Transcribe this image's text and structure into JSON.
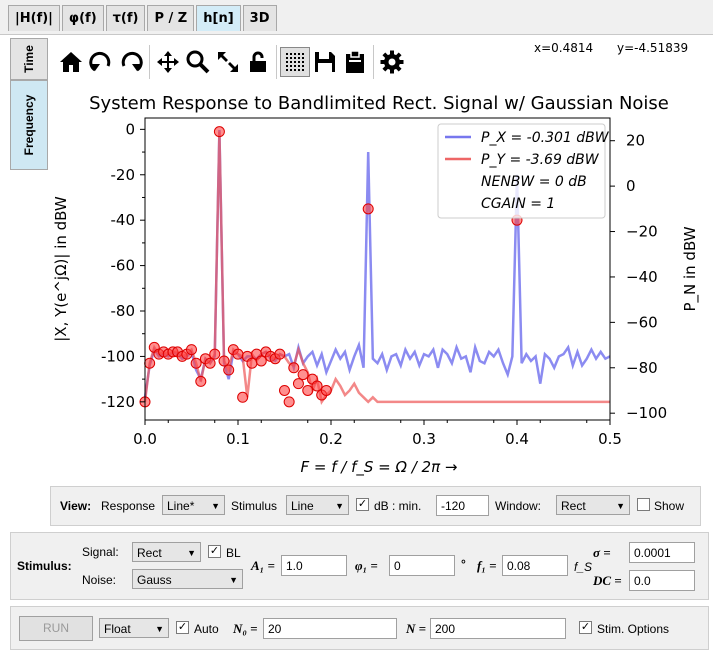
{
  "tabs": [
    {
      "label": "|H(f)|",
      "active": false
    },
    {
      "label": "φ(f)",
      "active": false
    },
    {
      "label": "τ(f)",
      "active": false
    },
    {
      "label": "P / Z",
      "active": false
    },
    {
      "label": "h[n]",
      "active": true
    },
    {
      "label": "3D",
      "active": false
    }
  ],
  "side_tabs": {
    "time": "Time",
    "frequency": "Frequency"
  },
  "toolbar": {
    "icons": [
      "home-icon",
      "back-icon",
      "forward-icon",
      "pan-icon",
      "zoom-icon",
      "autoscale-icon",
      "lock-icon",
      "grid-icon",
      "save-icon",
      "clipboard-icon",
      "settings-icon"
    ]
  },
  "coords": {
    "x": "x=0.4814",
    "y": "y=-4.51839"
  },
  "chart_data": {
    "type": "line",
    "title": "System Response to Bandlimited Rect. Signal w/ Gaussian Noise",
    "xlabel": "F = f / f_S = Ω / 2π →",
    "ylabel": "|X, Y(e^jΩ)| in dBW",
    "ylabel_right": "P_N in dBW",
    "xlim": [
      0,
      0.5
    ],
    "ylim": [
      -128,
      5
    ],
    "ylim_right": [
      -103,
      30
    ],
    "xticks": [
      0.0,
      0.1,
      0.2,
      0.3,
      0.4,
      0.5
    ],
    "yticks": [
      0,
      -20,
      -40,
      -60,
      -80,
      -100,
      -120
    ],
    "yticks_right": [
      20,
      0,
      -20,
      -40,
      -60,
      -80,
      -100
    ],
    "legend_position": "top-right",
    "legend": [
      {
        "label": "P_X = -0.301 dBW",
        "color": "#7777ee"
      },
      {
        "label": "P_Y = -3.69 dBW",
        "color": "#ee6666"
      },
      {
        "label": "NENBW = 0 dB"
      },
      {
        "label": "CGAIN  = 1"
      }
    ],
    "series": [
      {
        "name": "X",
        "color": "#7777ee",
        "x": [
          0,
          0.005,
          0.01,
          0.015,
          0.02,
          0.025,
          0.03,
          0.035,
          0.04,
          0.045,
          0.05,
          0.055,
          0.06,
          0.065,
          0.07,
          0.075,
          0.08,
          0.085,
          0.09,
          0.095,
          0.1,
          0.105,
          0.11,
          0.115,
          0.12,
          0.125,
          0.13,
          0.135,
          0.14,
          0.145,
          0.15,
          0.155,
          0.16,
          0.165,
          0.17,
          0.175,
          0.18,
          0.185,
          0.19,
          0.195,
          0.2,
          0.205,
          0.21,
          0.215,
          0.22,
          0.225,
          0.23,
          0.235,
          0.24,
          0.245,
          0.25,
          0.255,
          0.26,
          0.265,
          0.27,
          0.275,
          0.28,
          0.285,
          0.29,
          0.295,
          0.3,
          0.305,
          0.31,
          0.315,
          0.32,
          0.325,
          0.33,
          0.335,
          0.34,
          0.345,
          0.35,
          0.355,
          0.36,
          0.365,
          0.37,
          0.375,
          0.38,
          0.385,
          0.39,
          0.395,
          0.4,
          0.405,
          0.41,
          0.415,
          0.42,
          0.425,
          0.43,
          0.435,
          0.44,
          0.445,
          0.45,
          0.455,
          0.46,
          0.465,
          0.47,
          0.475,
          0.48,
          0.485,
          0.49,
          0.495,
          0.5
        ],
        "y": [
          -118,
          -104,
          -97,
          -100,
          -99,
          -100,
          -98,
          -99,
          -101,
          -100,
          -98,
          -106,
          -110,
          -101,
          -103,
          -100,
          -0.3,
          -103,
          -110,
          -98,
          -99,
          -102,
          -100,
          -100,
          -101,
          -99,
          -98,
          -101,
          -102,
          -99,
          -100,
          -99,
          -105,
          -96,
          -103,
          -100,
          -98,
          -104,
          -99,
          -107,
          -102,
          -97,
          -101,
          -98,
          -106,
          -100,
          -95,
          -105,
          -10,
          -101,
          -103,
          -99,
          -106,
          -100,
          -99,
          -104,
          -97,
          -101,
          -98,
          -104,
          -99,
          -100,
          -97,
          -105,
          -97,
          -99,
          -103,
          -96,
          -101,
          -100,
          -107,
          -96,
          -102,
          -103,
          -98,
          -100,
          -97,
          -103,
          -108,
          -100,
          -20,
          -103,
          -99,
          -102,
          -100,
          -112,
          -99,
          -101,
          -105,
          -100,
          -99,
          -96,
          -104,
          -98,
          -104,
          -101,
          -97,
          -101,
          -98,
          -101,
          -100
        ]
      },
      {
        "name": "Y",
        "color": "#ee5555",
        "x": [
          0,
          0.005,
          0.01,
          0.015,
          0.02,
          0.025,
          0.03,
          0.035,
          0.04,
          0.045,
          0.05,
          0.055,
          0.06,
          0.065,
          0.07,
          0.075,
          0.08,
          0.085,
          0.09,
          0.095,
          0.1,
          0.105,
          0.11,
          0.115,
          0.12,
          0.125,
          0.13,
          0.135,
          0.14,
          0.145,
          0.15,
          0.155,
          0.16,
          0.165,
          0.17,
          0.175,
          0.18,
          0.185,
          0.19,
          0.195,
          0.2,
          0.205,
          0.21,
          0.215,
          0.22,
          0.225,
          0.23,
          0.235,
          0.24,
          0.245,
          0.25,
          0.255,
          0.26,
          0.265,
          0.27,
          0.275,
          0.28,
          0.285,
          0.29,
          0.295,
          0.3,
          0.305,
          0.31,
          0.315,
          0.32,
          0.325,
          0.33,
          0.335,
          0.34,
          0.345,
          0.35,
          0.355,
          0.36,
          0.365,
          0.37,
          0.375,
          0.38,
          0.385,
          0.39,
          0.395,
          0.4,
          0.405,
          0.41,
          0.415,
          0.42,
          0.425,
          0.43,
          0.435,
          0.44,
          0.445,
          0.45,
          0.455,
          0.46,
          0.465,
          0.47,
          0.475,
          0.48,
          0.485,
          0.49,
          0.495,
          0.5
        ],
        "y": [
          -120,
          -103,
          -96,
          -99,
          -98,
          -99,
          -98,
          -98,
          -100,
          -99,
          -97,
          -103,
          -111,
          -101,
          -103,
          -99,
          -1,
          -102,
          -106,
          -97,
          -99,
          -100,
          -118,
          -99,
          -102,
          -99,
          -98,
          -100,
          -101,
          -99,
          -100,
          -103,
          -104,
          -97,
          -103,
          -107,
          -115,
          -110,
          -120,
          -117,
          -115,
          -110,
          -113,
          -117,
          -115,
          -112,
          -116,
          -118,
          -120,
          -118,
          -120,
          -120,
          -120,
          -120,
          -120,
          -120,
          -120,
          -120,
          -120,
          -120,
          -120,
          -120,
          -120,
          -120,
          -120,
          -120,
          -120,
          -120,
          -120,
          -120,
          -120,
          -120,
          -120,
          -120,
          -120,
          -120,
          -120,
          -120,
          -120,
          -120,
          -120,
          -120,
          -120,
          -120,
          -120,
          -120,
          -120,
          -120,
          -120,
          -120,
          -120,
          -120,
          -120,
          -120,
          -120,
          -120,
          -120,
          -120,
          -120,
          -120,
          -120
        ],
        "marker_x": [
          0,
          0.005,
          0.01,
          0.015,
          0.02,
          0.025,
          0.03,
          0.035,
          0.04,
          0.045,
          0.05,
          0.055,
          0.06,
          0.065,
          0.07,
          0.075,
          0.08,
          0.085,
          0.09,
          0.095,
          0.1,
          0.105,
          0.11,
          0.115,
          0.12,
          0.125,
          0.13,
          0.135,
          0.14,
          0.145,
          0.15,
          0.155,
          0.16,
          0.165,
          0.17,
          0.175,
          0.18,
          0.185,
          0.19,
          0.195,
          0.24,
          0.4
        ],
        "marker_y": [
          -120,
          -103,
          -96,
          -99,
          -98,
          -99,
          -98,
          -98,
          -100,
          -99,
          -97,
          -103,
          -111,
          -101,
          -103,
          -99,
          -1,
          -102,
          -106,
          -97,
          -99,
          -118,
          -100,
          -103,
          -99,
          -102,
          -98,
          -100,
          -101,
          -99,
          -115,
          -120,
          -105,
          -112,
          -108,
          -115,
          -110,
          -113,
          -117,
          -115,
          -35,
          -40
        ]
      }
    ]
  },
  "view": {
    "label": "View:",
    "response_label": "Response",
    "response_value": "Line*",
    "stimulus_label": "Stimulus",
    "stimulus_value": "Line",
    "db_label": "dB : min.",
    "db_checked": "✓",
    "db_min": "-120",
    "window_label": "Window:",
    "window_value": "Rect",
    "show_label": "Show"
  },
  "stimulus": {
    "label": "Stimulus:",
    "signal_label": "Signal:",
    "signal_value": "Rect",
    "bl_label": "BL",
    "bl_checked": "✓",
    "a1_label": "A₁ =",
    "a1_value": "1.0",
    "phi1_label": "φ₁ =",
    "phi1_value": "0",
    "deg_label": "°",
    "f1_label": "f₁ =",
    "f1_value": "0.08",
    "fs_label": "f_S",
    "sigma_label": "σ =",
    "sigma_value": "0.0001",
    "dc_label": "DC =",
    "dc_value": "0.0",
    "noise_label": "Noise:",
    "noise_value": "Gauss"
  },
  "run": {
    "run_label": "RUN",
    "format_value": "Float",
    "auto_label": "Auto",
    "auto_checked": "✓",
    "n0_label": "N₀ =",
    "n0_value": "20",
    "n_label": "N =",
    "n_value": "200",
    "stim_opts_label": "Stim. Options",
    "stim_opts_checked": "✓"
  }
}
